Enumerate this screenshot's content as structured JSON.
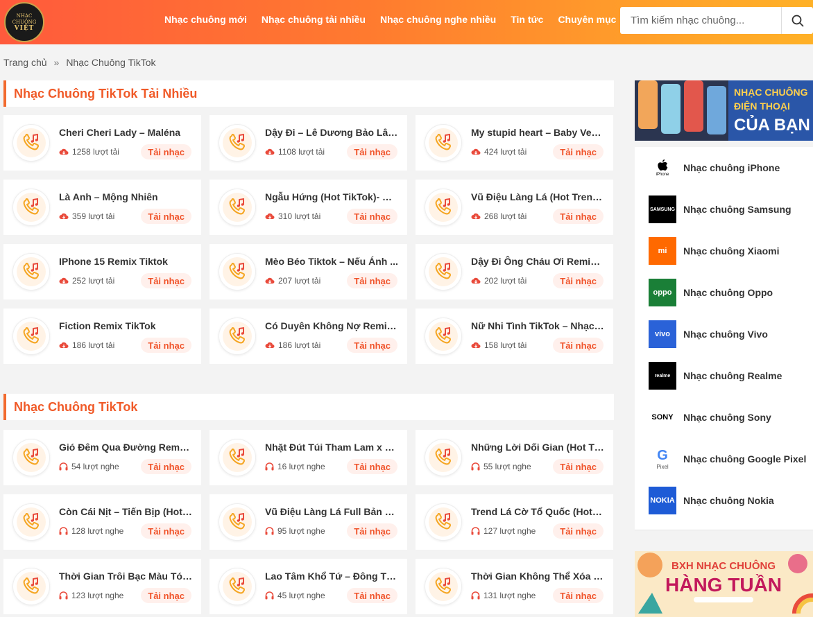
{
  "header": {
    "logo_line1": "NHẠC",
    "logo_line2": "CHUÔNG",
    "logo_line3": "VIỆT",
    "nav": [
      "Nhạc chuông mới",
      "Nhạc chuông tải nhiều",
      "Nhạc chuông nghe nhiều",
      "Tin tức",
      "Chuyên mục"
    ],
    "search_placeholder": "Tìm kiếm nhạc chuông..."
  },
  "breadcrumb": {
    "home": "Trang chủ",
    "separator": "»",
    "current": "Nhạc Chuông TikTok"
  },
  "section_top": {
    "title": "Nhạc Chuông TikTok Tải Nhiều",
    "items": [
      {
        "title": "Cheri Cheri Lady – Maléna",
        "count": "1258 lượt tải"
      },
      {
        "title": "Dậy Đi – Lê Dương Bảo Lâm ...",
        "count": "1108 lượt tải"
      },
      {
        "title": "My stupid heart – Baby Vers...",
        "count": "424 lượt tải"
      },
      {
        "title": "Là Anh – Mộng Nhiên",
        "count": "359 lượt tải"
      },
      {
        "title": "Ngẫu Hứng (Hot TikTok)- Ho...",
        "count": "310 lượt tải"
      },
      {
        "title": "Vũ Điệu Làng Lá (Hot Trend ...",
        "count": "268 lượt tải"
      },
      {
        "title": "IPhone 15 Remix Tiktok",
        "count": "252 lượt tải"
      },
      {
        "title": " Mèo Béo Tiktok – Nếu Ánh ...",
        "count": "207 lượt tải"
      },
      {
        "title": "Dậy Đi Ông Cháu Ơi Remix (...",
        "count": "202 lượt tải"
      },
      {
        "title": "Fiction Remix TikTok",
        "count": "186 lượt tải"
      },
      {
        "title": "Có Duyên Không Nợ Remix (...",
        "count": "186 lượt tải"
      },
      {
        "title": "Nữ Nhi Tình TikTok – Nhạc P...",
        "count": "158 lượt tải"
      }
    ]
  },
  "section_all": {
    "title": "Nhạc Chuông TikTok",
    "items": [
      {
        "title": "Gió Đêm Qua Đường Remix (...",
        "count": "54 lượt nghe"
      },
      {
        "title": "Nhặt Đút Túi Tham Lam x Cò...",
        "count": "16 lượt nghe"
      },
      {
        "title": "Những Lời Dối Gian (Hot Tik...",
        "count": "55 lượt nghe"
      },
      {
        "title": "Còn Cái Nịt – Tiến Bịp (Hot T...",
        "count": "128 lượt nghe"
      },
      {
        "title": "Vũ Điệu Làng Lá Full Bản Gốc",
        "count": "95 lượt nghe"
      },
      {
        "title": "Trend Lá Cờ Tổ Quốc (Hot Ti...",
        "count": "127 lượt nghe"
      },
      {
        "title": "Thời Gian Trôi Bạc Màu Tóc ...",
        "count": "123 lượt nghe"
      },
      {
        "title": "Lao Tâm Khổ Tứ – Đông Tha...",
        "count": "45 lượt nghe"
      },
      {
        "title": "Thời Gian Không Thể Xóa Nh...",
        "count": "131 lượt nghe"
      }
    ]
  },
  "download_label": "Tải nhạc",
  "sidebar": {
    "banner_line1": "NHẠC CHUÔNG",
    "banner_line2": "ĐIỆN THOẠI",
    "banner_line3": "CỦA BẠN",
    "brands": [
      {
        "name": "Nhạc chuông iPhone",
        "logo": "iPhone"
      },
      {
        "name": "Nhạc chuông Samsung",
        "logo": "SAMSUNG"
      },
      {
        "name": "Nhạc chuông Xiaomi",
        "logo": "mi"
      },
      {
        "name": "Nhạc chuông Oppo",
        "logo": "oppo"
      },
      {
        "name": "Nhạc chuông Vivo",
        "logo": "vivo"
      },
      {
        "name": "Nhạc chuông Realme",
        "logo": "realme"
      },
      {
        "name": "Nhạc chuông Sony",
        "logo": "SONY"
      },
      {
        "name": "Nhạc chuông Google Pixel",
        "logo": "Pixel"
      },
      {
        "name": "Nhạc chuông Nokia",
        "logo": "NOKIA"
      }
    ],
    "banner2_line1": "BXH NHẠC CHUÔNG",
    "banner2_line2": "HÀNG TUẦN"
  },
  "colors": {
    "accent": "#f05a28",
    "header_start": "#ff5a3c",
    "header_end": "#ffb127"
  }
}
